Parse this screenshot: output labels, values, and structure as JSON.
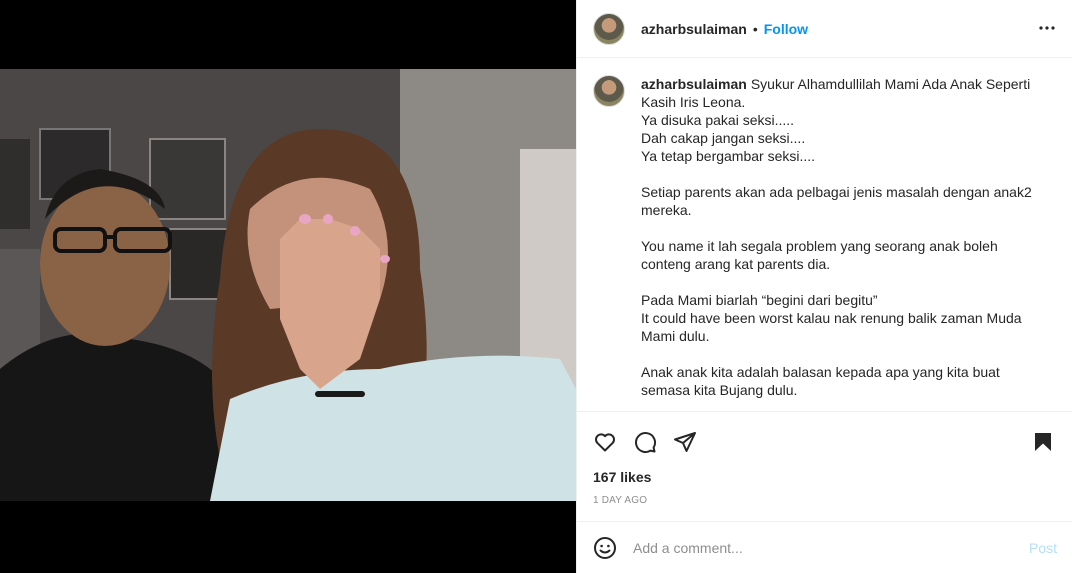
{
  "post": {
    "username": "azharbsulaiman",
    "separator": "•",
    "follow_label": "Follow",
    "caption_first": "Syukur Alhamdullilah Mami Ada Anak Seperti Kasih Iris Leona.",
    "caption_paragraphs": [
      "Ya disuka pakai seksi.....\nDah cakap jangan seksi....\nYa tetap bergambar seksi....",
      "Setiap parents akan ada pelbagai jenis masalah dengan anak2 mereka.",
      "You name it lah segala problem yang seorang anak boleh conteng arang kat parents dia.",
      "Pada Mami biarlah “begini dari begitu”\nIt could have been worst kalau nak renung balik zaman Muda Mami dulu.",
      "Anak anak kita adalah balasan kepada apa yang kita buat semasa kita Bujang dulu."
    ],
    "likes": "167 likes",
    "time_ago": "1 DAY AGO"
  },
  "comment": {
    "placeholder": "Add a comment...",
    "post_label": "Post"
  },
  "icons": {
    "more": "more-options-icon",
    "like": "heart-icon",
    "comment": "comment-icon",
    "share": "send-icon",
    "save": "bookmark-icon",
    "emoji": "emoji-icon"
  },
  "colors": {
    "accent": "#0095f6",
    "post_disabled": "#b2dffc",
    "muted": "#8e8e8e",
    "border": "#efefef"
  }
}
